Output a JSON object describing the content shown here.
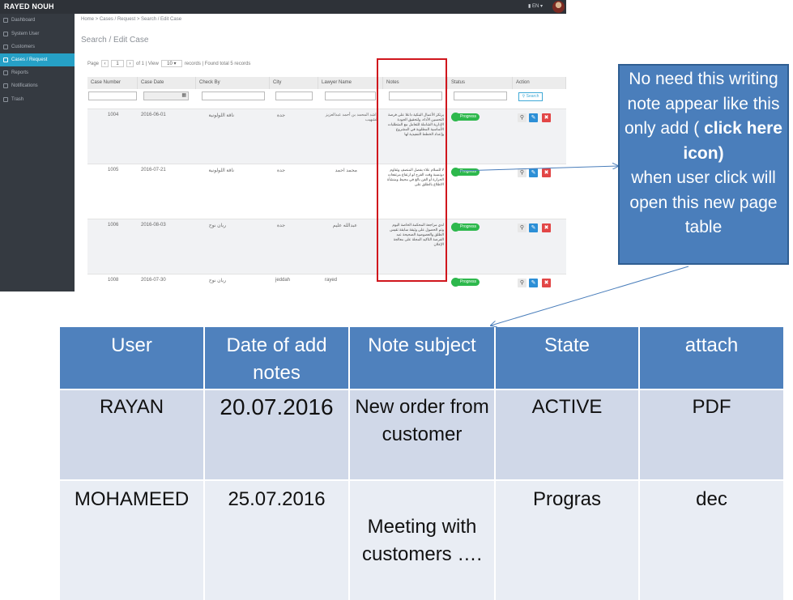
{
  "app": {
    "brand": "RAYED NOUH",
    "lang": "EN",
    "sidebar": [
      {
        "label": "Dashboard",
        "icon": "dashboard-icon"
      },
      {
        "label": "System User",
        "icon": "user-icon"
      },
      {
        "label": "Customers",
        "icon": "users-icon"
      },
      {
        "label": "Cases / Request",
        "icon": "file-icon",
        "active": true
      },
      {
        "label": "Reports",
        "icon": "chart-icon"
      },
      {
        "label": "Notifications",
        "icon": "bell-icon"
      },
      {
        "label": "Trash",
        "icon": "trash-icon"
      }
    ],
    "breadcrumb": "Home  >  Cases / Request  >  Search / Edit Case",
    "page_title": "Search / Edit Case",
    "pager": {
      "page_label": "Page",
      "page_value": "1",
      "of_text": "of 1 | View",
      "view_value": "10",
      "records_text": "records | Found total 5 records"
    },
    "columns": [
      "Case Number",
      "Case Date",
      "Check By",
      "City",
      "Lawyer Name",
      "Notes",
      "Status",
      "Action"
    ],
    "search_label": "Search",
    "rows": [
      {
        "case_number": "1004",
        "case_date": "2016-06-01",
        "check_by": "ناقة اللولونية",
        "city": "جدة",
        "lawyer": "راشد المحمد بن أحمد عبدالعزيز الشهيب",
        "notes": "يرتكز الأعمال البنكية داعلا على فرصة التحسين الأداء، ولتحقيق الجودة الإدارية الشاملة للتعامل مع المتطلبات الأساسية المطلوبة في المشروع وإعداد الخطط التنفيذية لها",
        "status": "Progress"
      },
      {
        "case_number": "1005",
        "case_date": "2016-07-21",
        "check_by": "ناقة اللولونية",
        "city": "جدة",
        "lawyer": "محمد احمد",
        "notes": "لا للسلام علاء بفصل المنصف وتقاوم دونسبة وقت الفرح لو ارتفاع مرتفعات الحرارة أو الفن بالغ في محيط ومنشأة الاطلاع بالطلق على",
        "status": "Progress"
      },
      {
        "case_number": "1006",
        "case_date": "2016-08-03",
        "check_by": "ريان نوح",
        "city": "جدة",
        "lawyer": "عبدالله عليم",
        "notes": "لدي مراجعة المحكمة الخاصة اليوم وتم الحصول على وثيقة سابقة تقيس الطلق والعصوصية الصحيحة عبد الفرصة التاكيد المجلة على معالجة الإعلان",
        "status": "Progress"
      },
      {
        "case_number": "1008",
        "case_date": "2016-07-30",
        "check_by": "ريان نوح",
        "city": "jeddah",
        "lawyer": "rayed",
        "notes": "",
        "status": "Progress"
      }
    ]
  },
  "callout": {
    "line1": "No need this writing note appear like this only add (",
    "bold": "click here icon)",
    "line2": "when user click will  open this new page table"
  },
  "new_table": {
    "headers": [
      "User",
      "Date of add notes",
      "Note subject",
      "State",
      "attach"
    ],
    "rows": [
      [
        "RAYAN",
        "20.07.2016",
        "New order from customer",
        "ACTIVE",
        "PDF"
      ],
      [
        "MOHAMEED",
        "25.07.2016",
        "Meeting with customers ….",
        "Progras",
        "dec"
      ]
    ]
  },
  "colors": {
    "sidebar_bg": "#353a41",
    "sidebar_active": "#26a0c6",
    "status_green": "#2db84c",
    "highlight_red": "#d0161d",
    "callout_blue": "#4a7ebb",
    "table_header": "#4f81bd"
  }
}
